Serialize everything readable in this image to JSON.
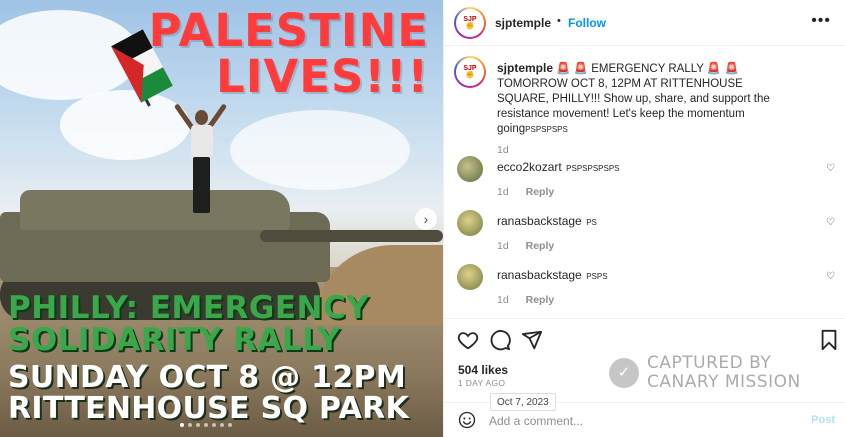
{
  "image": {
    "headline_line1": "PALESTINE",
    "headline_line2": "LIVES!!!",
    "green_line1": "PHILLY: EMERGENCY",
    "green_line2": "SOLIDARITY RALLY",
    "white_line1": "SUNDAY OCT 8 @ 12PM",
    "white_line2": "RITTENHOUSE SQ PARK",
    "next_icon": "chevron-right-icon",
    "carousel_dots": 7,
    "active_dot": 0
  },
  "header": {
    "username": "sjptemple",
    "separator": "•",
    "follow_label": "Follow",
    "more_icon": "•••"
  },
  "caption": {
    "username": "sjptemple",
    "text": "🚨 🚨 EMERGENCY RALLY 🚨 🚨 TOMORROW OCT 8, 12PM AT RITTENHOUSE SQUARE, PHILLY!!! Show up, share, and support the resistance movement! Let's keep the momentum going",
    "tail": "PSPSPSPS",
    "time": "1d"
  },
  "comments": [
    {
      "username": "ecco2kozart",
      "text": "PSPSPSPSPS",
      "time": "1d",
      "reply": "Reply"
    },
    {
      "username": "ranasbackstage",
      "text": "PS",
      "time": "1d",
      "reply": "Reply"
    },
    {
      "username": "ranasbackstage",
      "text": "PSPS",
      "time": "1d",
      "reply": "Reply"
    }
  ],
  "stats": {
    "likes": "504 likes",
    "ago": "1 DAY AGO",
    "tooltip": "Oct 7, 2023"
  },
  "composer": {
    "placeholder": "Add a comment...",
    "post_label": "Post"
  },
  "watermark": {
    "line1": "CAPTURED BY",
    "line2": "CANARY MISSION"
  },
  "colors": {
    "follow": "#0095f6",
    "headline": "#ff3b3b",
    "green_text": "#3aa84a"
  }
}
